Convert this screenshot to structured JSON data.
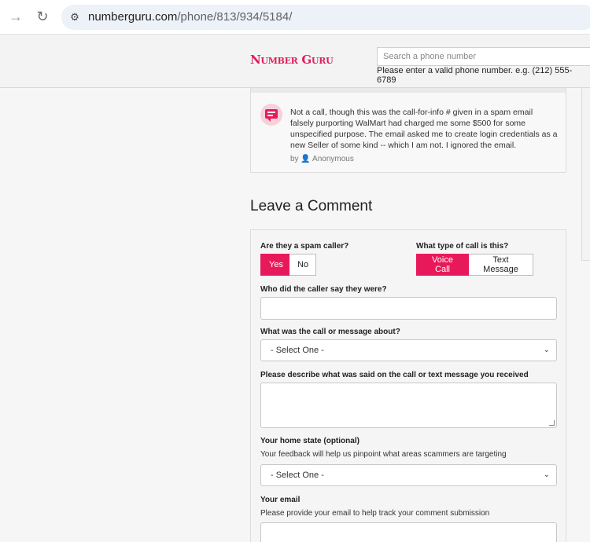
{
  "browser": {
    "url_domain": "numberguru.com",
    "url_path": "/phone/813/934/5184/",
    "back_icon": "→",
    "reload_icon": "↻"
  },
  "header": {
    "logo": "Number Guru",
    "search_placeholder": "Search a phone number",
    "search_hint": "Please enter a valid phone number. e.g. (212) 555-6789"
  },
  "comment": {
    "text": "Not a call, though this was the call-for-info # given in a spam email falsely purporting WalMart had charged me some $500 for some unspecified purpose. The email asked me to create login credentials as a new Seller of some kind -- which I am not. I ignored the email.",
    "by_label": "by",
    "author": "Anonymous"
  },
  "form": {
    "title": "Leave a Comment",
    "spam_label": "Are they a spam caller?",
    "spam_yes": "Yes",
    "spam_no": "No",
    "type_label": "What type of call is this?",
    "type_voice": "Voice Call",
    "type_text": "Text Message",
    "caller_label": "Who did the caller say they were?",
    "about_label": "What was the call or message about?",
    "about_selected": "- Select One -",
    "describe_label": "Please describe what was said on the call or text message you received",
    "state_label": "Your home state (optional)",
    "state_sub": "Your feedback will help us pinpoint what areas scammers are targeting",
    "state_selected": "- Select One -",
    "email_label": "Your email",
    "email_sub": "Please provide your email to help track your comment submission"
  },
  "colors": {
    "accent": "#e8195a",
    "logo": "#e01e5a"
  }
}
